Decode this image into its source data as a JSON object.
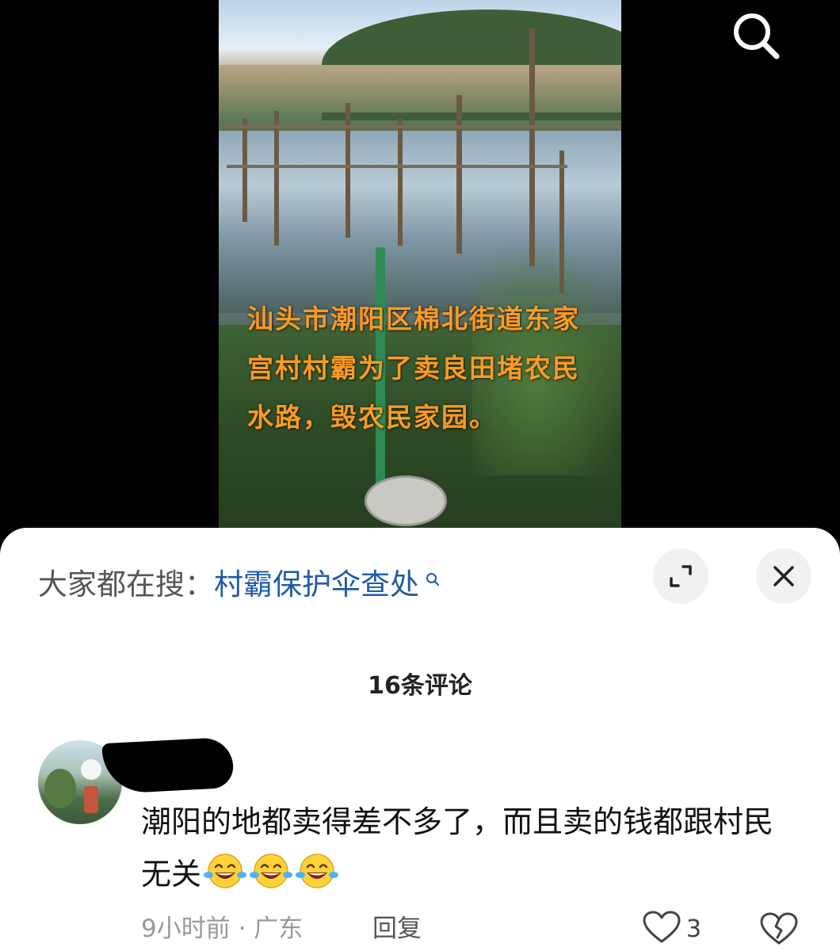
{
  "video": {
    "caption": "汕头市潮阳区棉北街道东家宫村村霸为了卖良田堵农民水路，毁农民家园。"
  },
  "search_bar": {
    "prefix": "大家都在搜：",
    "term": "村霸保护伞查处"
  },
  "comments": {
    "title": "16条评论",
    "items": [
      {
        "text": "潮阳的地都卖得差不多了，而且卖的钱都跟村民无关",
        "time_location": "9小时前 · 广东",
        "reply_label": "回复",
        "likes": "3"
      }
    ]
  },
  "icons": {
    "search": "search-icon",
    "expand": "expand-icon",
    "close": "close-icon",
    "like": "heart-icon",
    "dislike": "broken-heart-icon",
    "emoji": "laughing-crying-emoji"
  },
  "colors": {
    "caption": "#ff9a22",
    "search_term": "#1f5aa8"
  }
}
